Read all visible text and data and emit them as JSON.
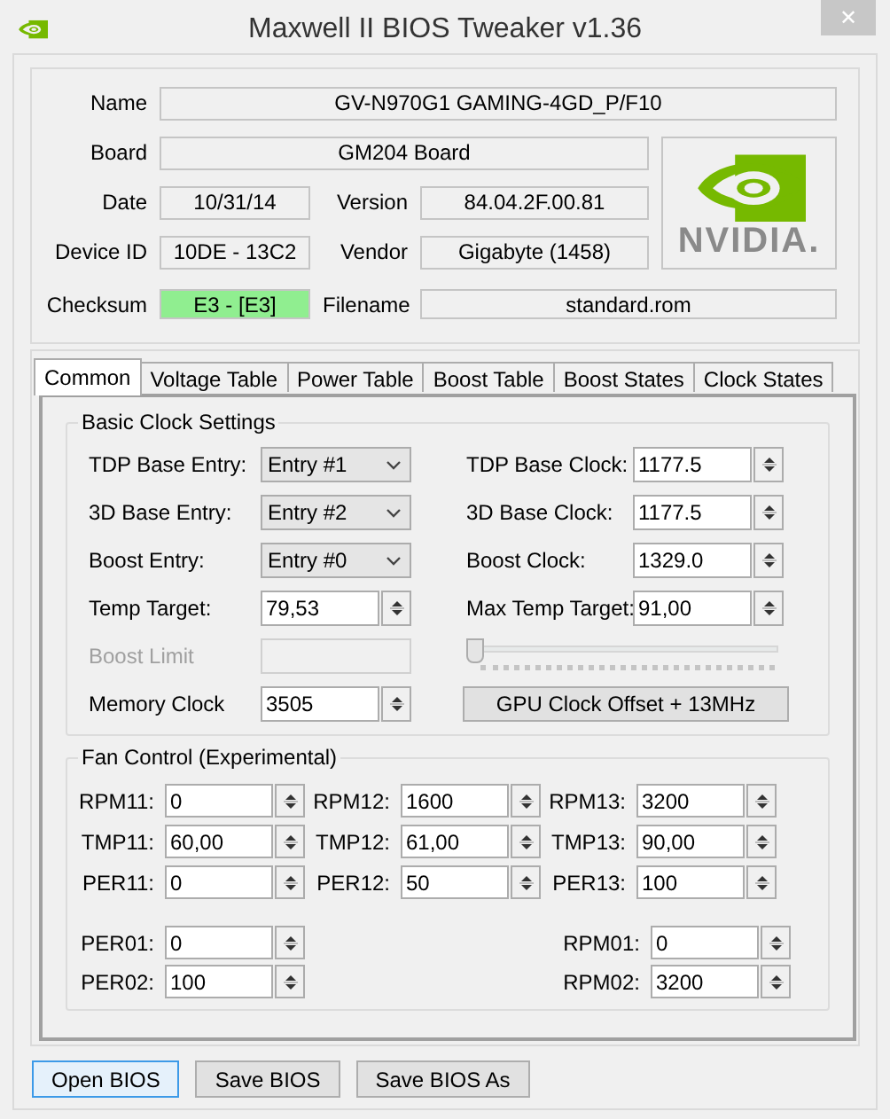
{
  "window": {
    "title": "Maxwell II BIOS Tweaker v1.36",
    "close": "✕"
  },
  "info": {
    "name": {
      "label": "Name",
      "value": "GV-N970G1 GAMING-4GD_P/F10"
    },
    "board": {
      "label": "Board",
      "value": "GM204 Board"
    },
    "date": {
      "label": "Date",
      "value": "10/31/14"
    },
    "version": {
      "label": "Version",
      "value": "84.04.2F.00.81"
    },
    "device_id": {
      "label": "Device ID",
      "value": "10DE - 13C2"
    },
    "vendor": {
      "label": "Vendor",
      "value": "Gigabyte (1458)"
    },
    "checksum": {
      "label": "Checksum",
      "value": "E3 - [E3]",
      "valid": true
    },
    "filename": {
      "label": "Filename",
      "value": "standard.rom"
    },
    "logo_text": "NVIDIA."
  },
  "tabs": [
    {
      "label": "Common",
      "selected": true
    },
    {
      "label": "Voltage Table",
      "selected": false
    },
    {
      "label": "Power Table",
      "selected": false
    },
    {
      "label": "Boost Table",
      "selected": false
    },
    {
      "label": "Boost States",
      "selected": false
    },
    {
      "label": "Clock States",
      "selected": false
    }
  ],
  "basic_clock": {
    "title": "Basic Clock Settings",
    "left": [
      {
        "kind": "combo",
        "label": "TDP Base Entry:",
        "value": "Entry #1",
        "disabled": false
      },
      {
        "kind": "combo",
        "label": "3D Base Entry:",
        "value": "Entry #2",
        "disabled": false
      },
      {
        "kind": "combo",
        "label": "Boost Entry:",
        "value": "Entry #0",
        "disabled": false
      },
      {
        "kind": "spin",
        "label": "Temp Target:",
        "value": "79,53",
        "disabled": false
      },
      {
        "kind": "text",
        "label": "Boost Limit",
        "disabled": true
      },
      {
        "kind": "spin",
        "label": "Memory Clock",
        "value": "3505",
        "disabled": false
      }
    ],
    "right": [
      {
        "kind": "spin",
        "label": "TDP Base Clock:",
        "value": "1177.5"
      },
      {
        "kind": "spin",
        "label": "3D Base Clock:",
        "value": "1177.5"
      },
      {
        "kind": "spin",
        "label": "Boost Clock:",
        "value": "1329.0"
      },
      {
        "kind": "spin",
        "label": "Max Temp Target:",
        "value": "91,00"
      },
      {
        "kind": "slider",
        "level": 0
      },
      {
        "kind": "button",
        "label": "GPU Clock Offset + 13MHz"
      }
    ]
  },
  "fan_control": {
    "title": "Fan Control (Experimental)",
    "curve_rows": [
      [
        {
          "label": "RPM11:",
          "value": "0"
        },
        {
          "label": "RPM12:",
          "value": "1600"
        },
        {
          "label": "RPM13:",
          "value": "3200"
        }
      ],
      [
        {
          "label": "TMP11:",
          "value": "60,00"
        },
        {
          "label": "TMP12:",
          "value": "61,00"
        },
        {
          "label": "TMP13:",
          "value": "90,00"
        }
      ],
      [
        {
          "label": "PER11:",
          "value": "0"
        },
        {
          "label": "PER12:",
          "value": "50"
        },
        {
          "label": "PER13:",
          "value": "100"
        }
      ]
    ],
    "limits_left": [
      {
        "label": "PER01:",
        "value": "0"
      },
      {
        "label": "PER02:",
        "value": "100"
      }
    ],
    "limits_right": [
      {
        "label": "RPM01:",
        "value": "0"
      },
      {
        "label": "RPM02:",
        "value": "3200"
      }
    ]
  },
  "buttons": [
    {
      "label": "Open BIOS",
      "focused": true
    },
    {
      "label": "Save BIOS",
      "focused": false
    },
    {
      "label": "Save BIOS As",
      "focused": false
    }
  ]
}
